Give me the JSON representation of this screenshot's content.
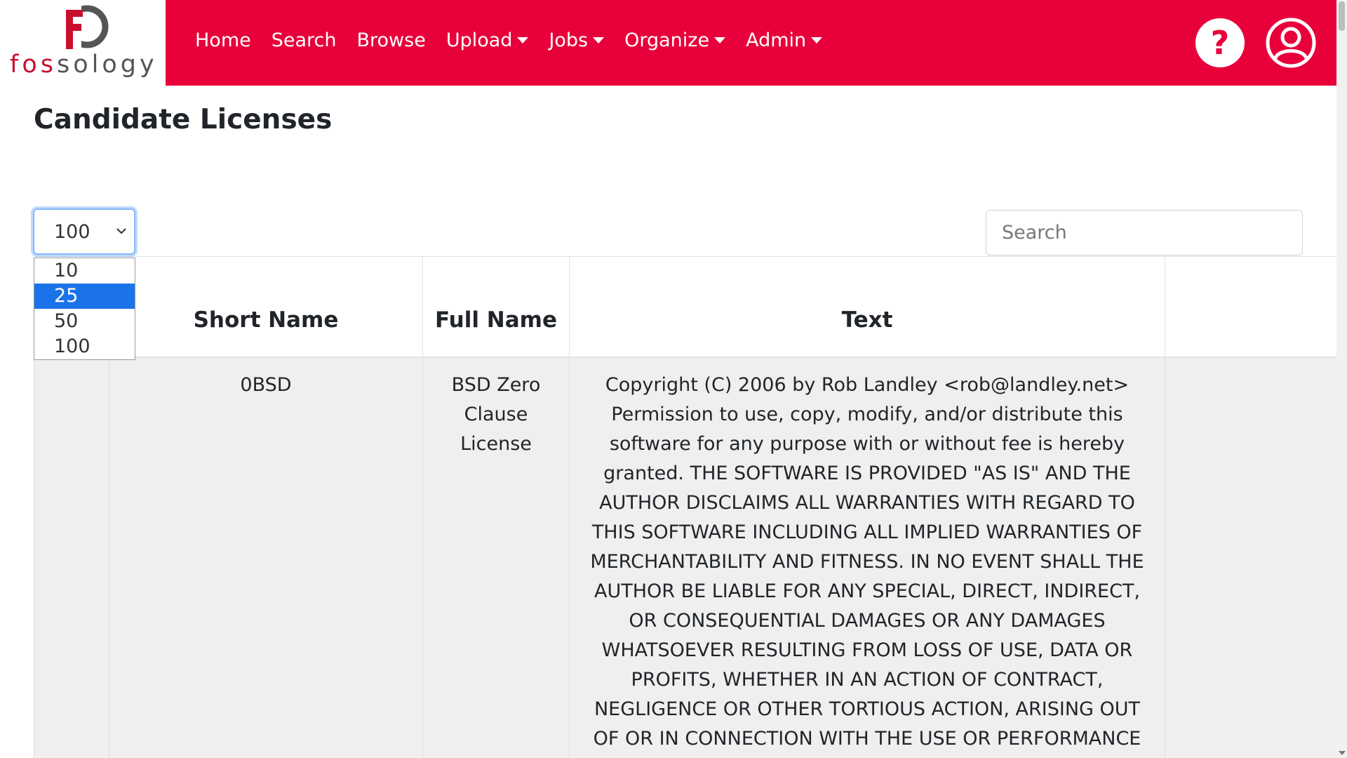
{
  "brand": {
    "text_red": "fos",
    "text_gray": "sology",
    "accent": "#e8003a"
  },
  "nav": {
    "items": [
      {
        "label": "Home",
        "dropdown": false
      },
      {
        "label": "Search",
        "dropdown": false
      },
      {
        "label": "Browse",
        "dropdown": false
      },
      {
        "label": "Upload",
        "dropdown": true
      },
      {
        "label": "Jobs",
        "dropdown": true
      },
      {
        "label": "Organize",
        "dropdown": true
      },
      {
        "label": "Admin",
        "dropdown": true
      }
    ],
    "help_icon": "question-circle-icon",
    "user_icon": "user-circle-icon"
  },
  "page": {
    "title": "Candidate Licenses"
  },
  "length_select": {
    "value": "100",
    "options": [
      "10",
      "25",
      "50",
      "100"
    ],
    "highlighted": "25"
  },
  "search": {
    "placeholder": "Search",
    "value": ""
  },
  "table": {
    "columns": [
      "",
      "Short Name",
      "Full Name",
      "Text",
      ""
    ],
    "rows": [
      {
        "col0": "",
        "short_name": "0BSD",
        "full_name": "BSD Zero Clause License",
        "text": "Copyright (C) 2006 by Rob Landley <rob@landley.net> Permission to use, copy, modify, and/or distribute this software for any purpose with or without fee is hereby granted. THE SOFTWARE IS PROVIDED \"AS IS\" AND THE AUTHOR DISCLAIMS ALL WARRANTIES WITH REGARD TO THIS SOFTWARE INCLUDING ALL IMPLIED WARRANTIES OF MERCHANTABILITY AND FITNESS. IN NO EVENT SHALL THE AUTHOR BE LIABLE FOR ANY SPECIAL, DIRECT, INDIRECT, OR CONSEQUENTIAL DAMAGES OR ANY DAMAGES WHATSOEVER RESULTING FROM LOSS OF USE, DATA OR PROFITS, WHETHER IN AN ACTION OF CONTRACT, NEGLIGENCE OR OTHER TORTIOUS ACTION, ARISING OUT OF OR IN CONNECTION WITH THE USE OR PERFORMANCE",
        "col4": ""
      }
    ]
  }
}
